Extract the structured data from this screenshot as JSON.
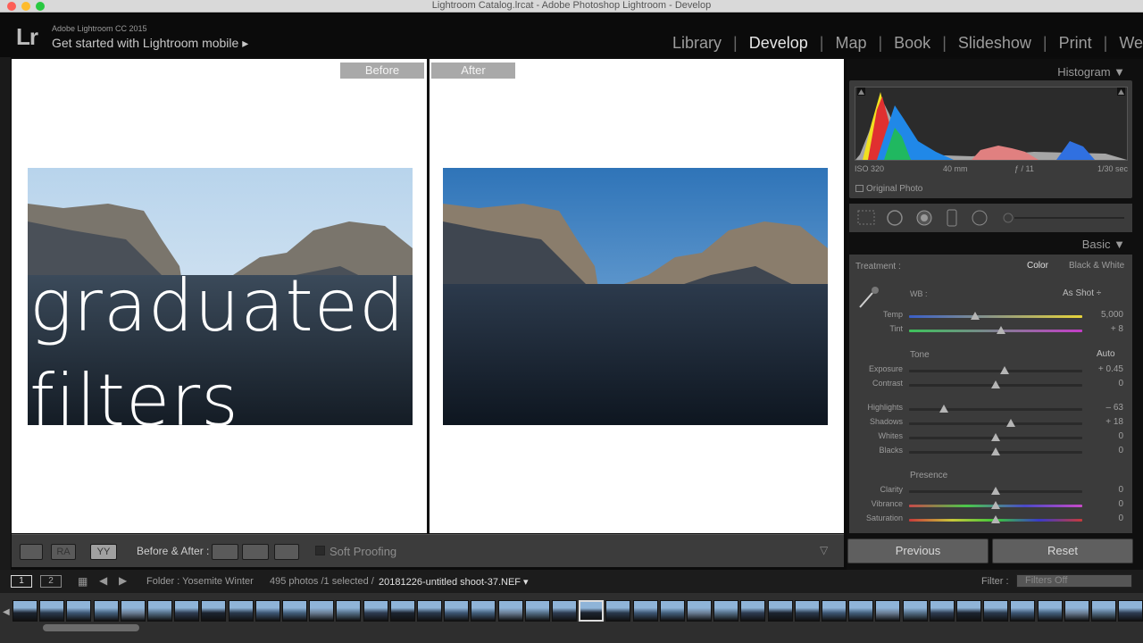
{
  "window": {
    "title": "Lightroom Catalog.lrcat - Adobe Photoshop Lightroom - Develop"
  },
  "header": {
    "logo": "Lr",
    "product": "Adobe Lightroom CC 2015",
    "mobile_link": "Get started with Lightroom mobile ▸",
    "modules": [
      "Library",
      "Develop",
      "Map",
      "Book",
      "Slideshow",
      "Print",
      "We"
    ],
    "active_module": "Develop"
  },
  "view": {
    "before_label": "Before",
    "after_label": "After",
    "overlay_line1": "graduated",
    "overlay_line2": "filters"
  },
  "toolbar": {
    "ba_label": "Before & After :",
    "soft_proofing": "Soft Proofing",
    "view_buttons": [
      "RA",
      "YY"
    ]
  },
  "histogram": {
    "title": "Histogram ▼",
    "iso": "ISO 320",
    "focal": "40 mm",
    "aperture": "ƒ / 11",
    "shutter": "1/30 sec",
    "original_photo": "Original Photo"
  },
  "basic": {
    "title": "Basic ▼",
    "treatment_label": "Treatment :",
    "treatment_color": "Color",
    "treatment_bw": "Black & White",
    "wb_label": "WB :",
    "wb_value": "As Shot ÷",
    "tone_label": "Tone",
    "auto_label": "Auto",
    "presence_label": "Presence",
    "sliders": [
      {
        "label": "Temp",
        "value": "5,000",
        "pos": 0.38
      },
      {
        "label": "Tint",
        "value": "+ 8",
        "pos": 0.53
      },
      {
        "label": "Exposure",
        "value": "+ 0.45",
        "pos": 0.55
      },
      {
        "label": "Contrast",
        "value": "0",
        "pos": 0.5
      },
      {
        "label": "Highlights",
        "value": "– 63",
        "pos": 0.2
      },
      {
        "label": "Shadows",
        "value": "+ 18",
        "pos": 0.59
      },
      {
        "label": "Whites",
        "value": "0",
        "pos": 0.5
      },
      {
        "label": "Blacks",
        "value": "0",
        "pos": 0.5
      },
      {
        "label": "Clarity",
        "value": "0",
        "pos": 0.5
      },
      {
        "label": "Vibrance",
        "value": "0",
        "pos": 0.5
      },
      {
        "label": "Saturation",
        "value": "0",
        "pos": 0.5
      }
    ]
  },
  "buttons": {
    "previous": "Previous",
    "reset": "Reset"
  },
  "filmbar": {
    "page1": "1",
    "page2": "2",
    "folder": "Folder : Yosemite Winter",
    "count": "495 photos /1 selected /",
    "filename": "20181226-untitled shoot-37.NEF ▾",
    "filter_label": "Filter :",
    "filter_value": "Filters Off"
  },
  "colors": {
    "accent": "#e6e6e6",
    "panel": "#3b3b3b"
  }
}
